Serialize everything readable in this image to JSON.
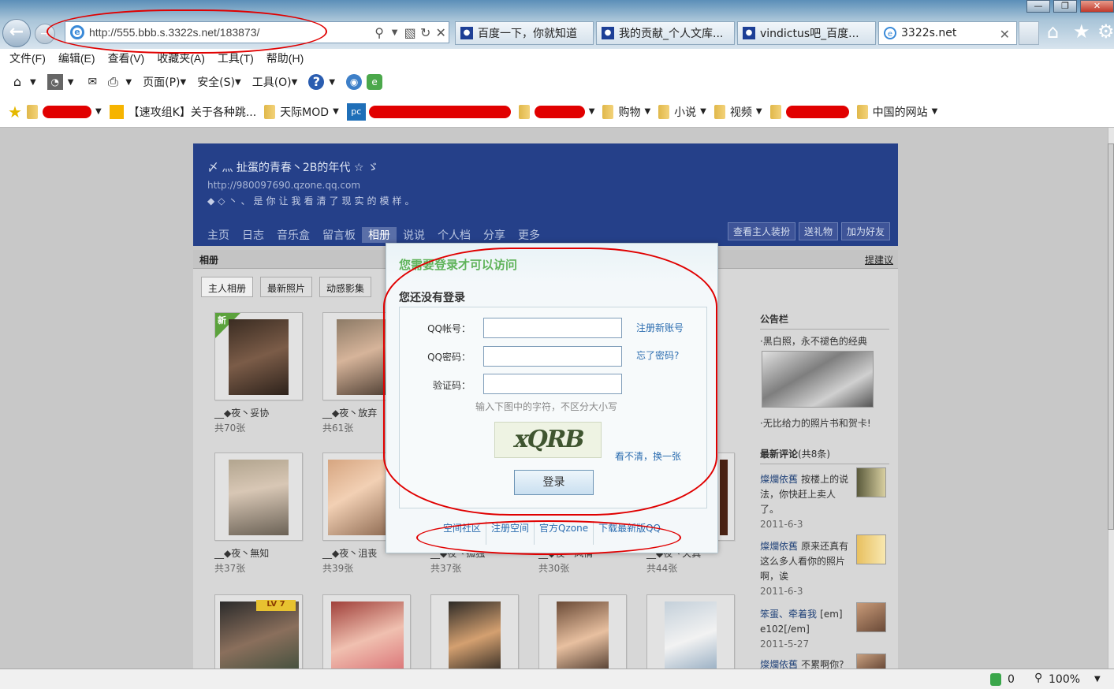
{
  "browser": {
    "url": "http://555.bbb.s.3322s.net/183873/",
    "tabs": [
      {
        "label": "百度一下，你就知道"
      },
      {
        "label": "我的贡献_个人文库..."
      },
      {
        "label": "vindictus吧_百度..."
      },
      {
        "label": "3322s.net"
      }
    ],
    "menu": [
      "文件(F)",
      "编辑(E)",
      "查看(V)",
      "收藏夹(A)",
      "工具(T)",
      "帮助(H)"
    ],
    "cmd": {
      "page": "页面(P)",
      "safety": "安全(S)",
      "tools": "工具(O)"
    },
    "favorites": [
      "【速攻组K】关于各种跳...",
      "天际MOD",
      "购物",
      "小说",
      "视频",
      "中国的网站"
    ],
    "status": {
      "count": "0",
      "zoom": "100%"
    }
  },
  "qzone": {
    "title": "〆 灬 扯蛋的青春丶2B的年代 ☆ ゞ",
    "url": "http://980097690.qzone.qq.com",
    "signature": "◆◇丶、是你让我看清了现实的模样。",
    "nav": [
      "主页",
      "日志",
      "音乐盒",
      "留言板",
      "相册",
      "说说",
      "个人档",
      "分享",
      "更多"
    ],
    "actions": [
      "查看主人装扮",
      "送礼物",
      "加为好友"
    ],
    "section": "相册",
    "suggest": "提建议",
    "subtabs": [
      "主人相册",
      "最新照片",
      "动感影集"
    ],
    "albums": [
      {
        "name": "__◆夜丶妥协",
        "count": "共70张",
        "badge": "新"
      },
      {
        "name": "__◆夜丶放弃",
        "count": "共61张"
      },
      {
        "name": "__◆夜丶無知",
        "count": "共37张"
      },
      {
        "name": "__◆夜丶沮丧",
        "count": "共39张"
      },
      {
        "name": "__◆夜丶孤独",
        "count": "共37张"
      },
      {
        "name": "__◆夜丶风情",
        "count": "共30张"
      },
      {
        "name": "__◆夜丶天真",
        "count": "共44张"
      }
    ],
    "lv_badge": "LV 7",
    "notice": {
      "title": "公告栏",
      "line1": "·黑白照，永不褪色的经典",
      "line2": "·无比给力的照片书和贺卡!"
    },
    "comments": {
      "title": "最新评论",
      "count": "(共8条)",
      "items": [
        {
          "user": "燦爛依舊",
          "text": "按楼上的说法，你快赶上卖人了。",
          "date": "2011-6-3"
        },
        {
          "user": "燦爛依舊",
          "text": "原来还真有这么多人看你的照片啊，诶",
          "date": "2011-6-3"
        },
        {
          "user": "笨蛋、牵着我",
          "text": "[em] e102[/em]",
          "date": "2011-5-27"
        },
        {
          "user": "燦爛依舊",
          "text": "不累啊你?",
          "date": ""
        }
      ]
    }
  },
  "dialog": {
    "title": "您需要登录才可以访问",
    "subtitle": "您还没有登录",
    "qq_label": "QQ帐号：",
    "pwd_label": "QQ密码：",
    "code_label": "验证码：",
    "register_link": "注册新账号",
    "forgot_link": "忘了密码?",
    "hint": "输入下图中的字符，不区分大小写",
    "captcha_text": "xQRB",
    "refresh_link": "看不清，换一张",
    "login": "登录",
    "footer": [
      "空间社区",
      "注册空间",
      "官方Qzone",
      "下载最新版QQ"
    ]
  }
}
